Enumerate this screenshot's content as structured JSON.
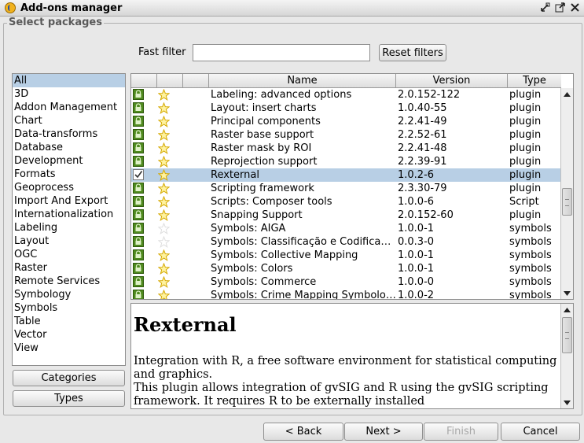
{
  "window": {
    "title": "Add-ons manager"
  },
  "group": {
    "title": "Select packages"
  },
  "filter": {
    "label": "Fast filter",
    "value": "",
    "reset_label": "Reset filters"
  },
  "categories": [
    "All",
    "3D",
    "Addon Management",
    "Chart",
    "Data-transforms",
    "Database",
    "Development",
    "Formats",
    "Geoprocess",
    "Import And Export",
    "Internationalization",
    "Labeling",
    "Layout",
    "OGC",
    "Raster",
    "Remote Services",
    "Symbology",
    "Symbols",
    "Table",
    "Vector",
    "View"
  ],
  "selected_category": "All",
  "buttons": {
    "categories": "Categories",
    "types": "Types"
  },
  "table": {
    "columns": [
      "",
      "",
      "",
      "Name",
      "Version",
      "Type"
    ],
    "rows": [
      {
        "status": "lock",
        "rating": "star",
        "name": "Labeling: advanced options",
        "version": "2.0.152-122",
        "type": "plugin"
      },
      {
        "status": "lock",
        "rating": "star",
        "name": "Layout: insert charts",
        "version": "1.0.40-55",
        "type": "plugin"
      },
      {
        "status": "lock",
        "rating": "star",
        "name": "Principal components",
        "version": "2.2.41-49",
        "type": "plugin"
      },
      {
        "status": "lock",
        "rating": "star",
        "name": "Raster base support",
        "version": "2.2.52-61",
        "type": "plugin"
      },
      {
        "status": "lock",
        "rating": "star",
        "name": "Raster mask by ROI",
        "version": "2.2.41-48",
        "type": "plugin"
      },
      {
        "status": "lock",
        "rating": "star",
        "name": "Reprojection support",
        "version": "2.2.39-91",
        "type": "plugin"
      },
      {
        "status": "check",
        "rating": "star",
        "name": "Rexternal",
        "version": "1.0.2-6",
        "type": "plugin",
        "selected": true
      },
      {
        "status": "lock",
        "rating": "star",
        "name": "Scripting framework",
        "version": "2.3.30-79",
        "type": "plugin"
      },
      {
        "status": "lock",
        "rating": "star",
        "name": "Scripts: Composer tools",
        "version": "1.0.0-6",
        "type": "Script"
      },
      {
        "status": "lock",
        "rating": "star",
        "name": "Snapping Support",
        "version": "2.0.152-60",
        "type": "plugin"
      },
      {
        "status": "lock",
        "rating": "star-faint",
        "name": "Symbols: AIGA",
        "version": "1.0.0-1",
        "type": "symbols"
      },
      {
        "status": "lock",
        "rating": "star-faint",
        "name": "Symbols: Classificação e Codificaçã...",
        "version": "0.0.3-0",
        "type": "symbols"
      },
      {
        "status": "lock",
        "rating": "star",
        "name": "Symbols: Collective Mapping",
        "version": "1.0.0-1",
        "type": "symbols"
      },
      {
        "status": "lock",
        "rating": "star",
        "name": "Symbols: Colors",
        "version": "1.0.0-1",
        "type": "symbols"
      },
      {
        "status": "lock",
        "rating": "star",
        "name": "Symbols: Commerce",
        "version": "1.0.0-0",
        "type": "symbols"
      },
      {
        "status": "lock",
        "rating": "star",
        "name": "Symbols: Crime Mapping Symbology...",
        "version": "1.0.0-2",
        "type": "symbols"
      }
    ]
  },
  "description": {
    "title": "Rexternal",
    "lines": [
      "Integration with R, a free software environment for statistical computing",
      "and graphics.",
      "This plugin allows integration of gvSIG and R using the gvSIG scripting",
      "framework. It requires R to be externally installed"
    ]
  },
  "nav": {
    "back": "< Back",
    "next": "Next >",
    "finish": "Finish",
    "cancel": "Cancel"
  },
  "colors": {
    "selection": "#b8cfe5",
    "lock_green": "#4f8a1e",
    "star_yellow": "#f5d21a"
  }
}
